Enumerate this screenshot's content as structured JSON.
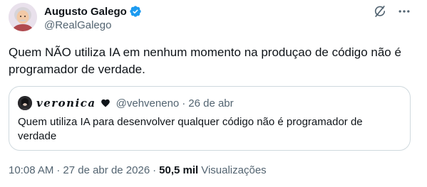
{
  "author": {
    "display_name": "Augusto Galego",
    "handle": "@RealGalego",
    "verified": true
  },
  "tweet": {
    "text": "Quem NÃO utiliza IA em nenhum momento na produçao de código não é programador de verdade."
  },
  "quoted_tweet": {
    "display_name": "veronica",
    "handle": "@vehveneno",
    "separator": "·",
    "date": "26 de abr",
    "text": "Quem utiliza IA para desenvolver qualquer código não é programador de verdade"
  },
  "meta": {
    "time": "10:08 AM",
    "separator": "·",
    "date": "27 de abr de 2026",
    "separator2": "·",
    "views_count": "50,5 mil",
    "views_label": "Visualizações"
  },
  "icons": {
    "verified": "verified-badge-icon",
    "grok": "grok-icon",
    "more": "more-icon",
    "heart": "black-heart-icon"
  },
  "colors": {
    "verified_blue": "#1d9bf0",
    "secondary_text": "#536471",
    "primary_text": "#0f1419",
    "border": "#cfd9de"
  }
}
